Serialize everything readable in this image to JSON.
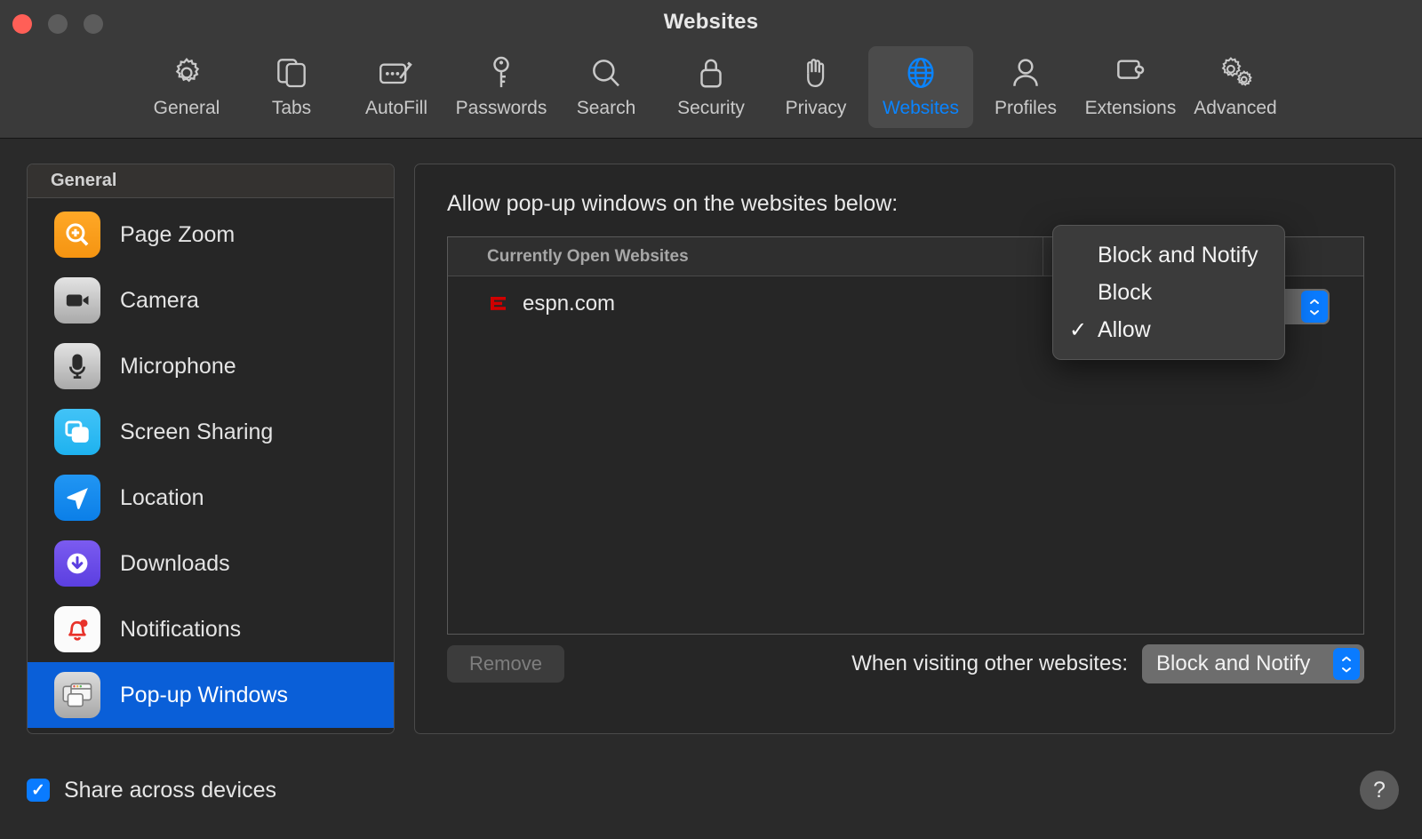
{
  "window": {
    "title": "Websites",
    "traffic_lights": [
      "close-button",
      "minimize-button",
      "zoom-button"
    ]
  },
  "toolbar": {
    "tabs": [
      {
        "label": "General",
        "icon": "gear-icon",
        "selected": false
      },
      {
        "label": "Tabs",
        "icon": "tabs-icon",
        "selected": false
      },
      {
        "label": "AutoFill",
        "icon": "autofill-icon",
        "selected": false
      },
      {
        "label": "Passwords",
        "icon": "key-icon",
        "selected": false
      },
      {
        "label": "Search",
        "icon": "search-icon",
        "selected": false
      },
      {
        "label": "Security",
        "icon": "lock-icon",
        "selected": false
      },
      {
        "label": "Privacy",
        "icon": "hand-icon",
        "selected": false
      },
      {
        "label": "Websites",
        "icon": "globe-icon",
        "selected": true
      },
      {
        "label": "Profiles",
        "icon": "person-icon",
        "selected": false
      },
      {
        "label": "Extensions",
        "icon": "puzzle-icon",
        "selected": false
      },
      {
        "label": "Advanced",
        "icon": "gears-icon",
        "selected": false
      }
    ],
    "accent_color": "#0a84ff",
    "selected_tab_bg": "#4b4b4b"
  },
  "sidebar": {
    "header": "General",
    "items": [
      {
        "label": "Page Zoom",
        "icon": "page-zoom-icon",
        "selected": false
      },
      {
        "label": "Camera",
        "icon": "camera-icon",
        "selected": false
      },
      {
        "label": "Microphone",
        "icon": "microphone-icon",
        "selected": false
      },
      {
        "label": "Screen Sharing",
        "icon": "screen-sharing-icon",
        "selected": false
      },
      {
        "label": "Location",
        "icon": "location-icon",
        "selected": false
      },
      {
        "label": "Downloads",
        "icon": "downloads-icon",
        "selected": false
      },
      {
        "label": "Notifications",
        "icon": "notifications-icon",
        "selected": false
      },
      {
        "label": "Pop-up Windows",
        "icon": "popup-windows-icon",
        "selected": true
      }
    ],
    "selection_color": "#0a5fd8"
  },
  "main": {
    "heading": "Allow pop-up windows on the websites below:",
    "table": {
      "column_header": "Currently Open Websites",
      "rows": [
        {
          "site": "espn.com",
          "favicon": "espn-logo-icon",
          "setting": "Allow"
        }
      ]
    },
    "remove_button": "Remove",
    "other_websites_label": "When visiting other websites:",
    "other_websites_value": "Block and Notify"
  },
  "menu": {
    "items": [
      {
        "label": "Block and Notify",
        "checked": false
      },
      {
        "label": "Block",
        "checked": false
      },
      {
        "label": "Allow",
        "checked": true
      }
    ],
    "check_glyph": "✓"
  },
  "bottom": {
    "share_label": "Share across devices",
    "share_checked": true,
    "check_glyph": "✓",
    "help_label": "?"
  }
}
